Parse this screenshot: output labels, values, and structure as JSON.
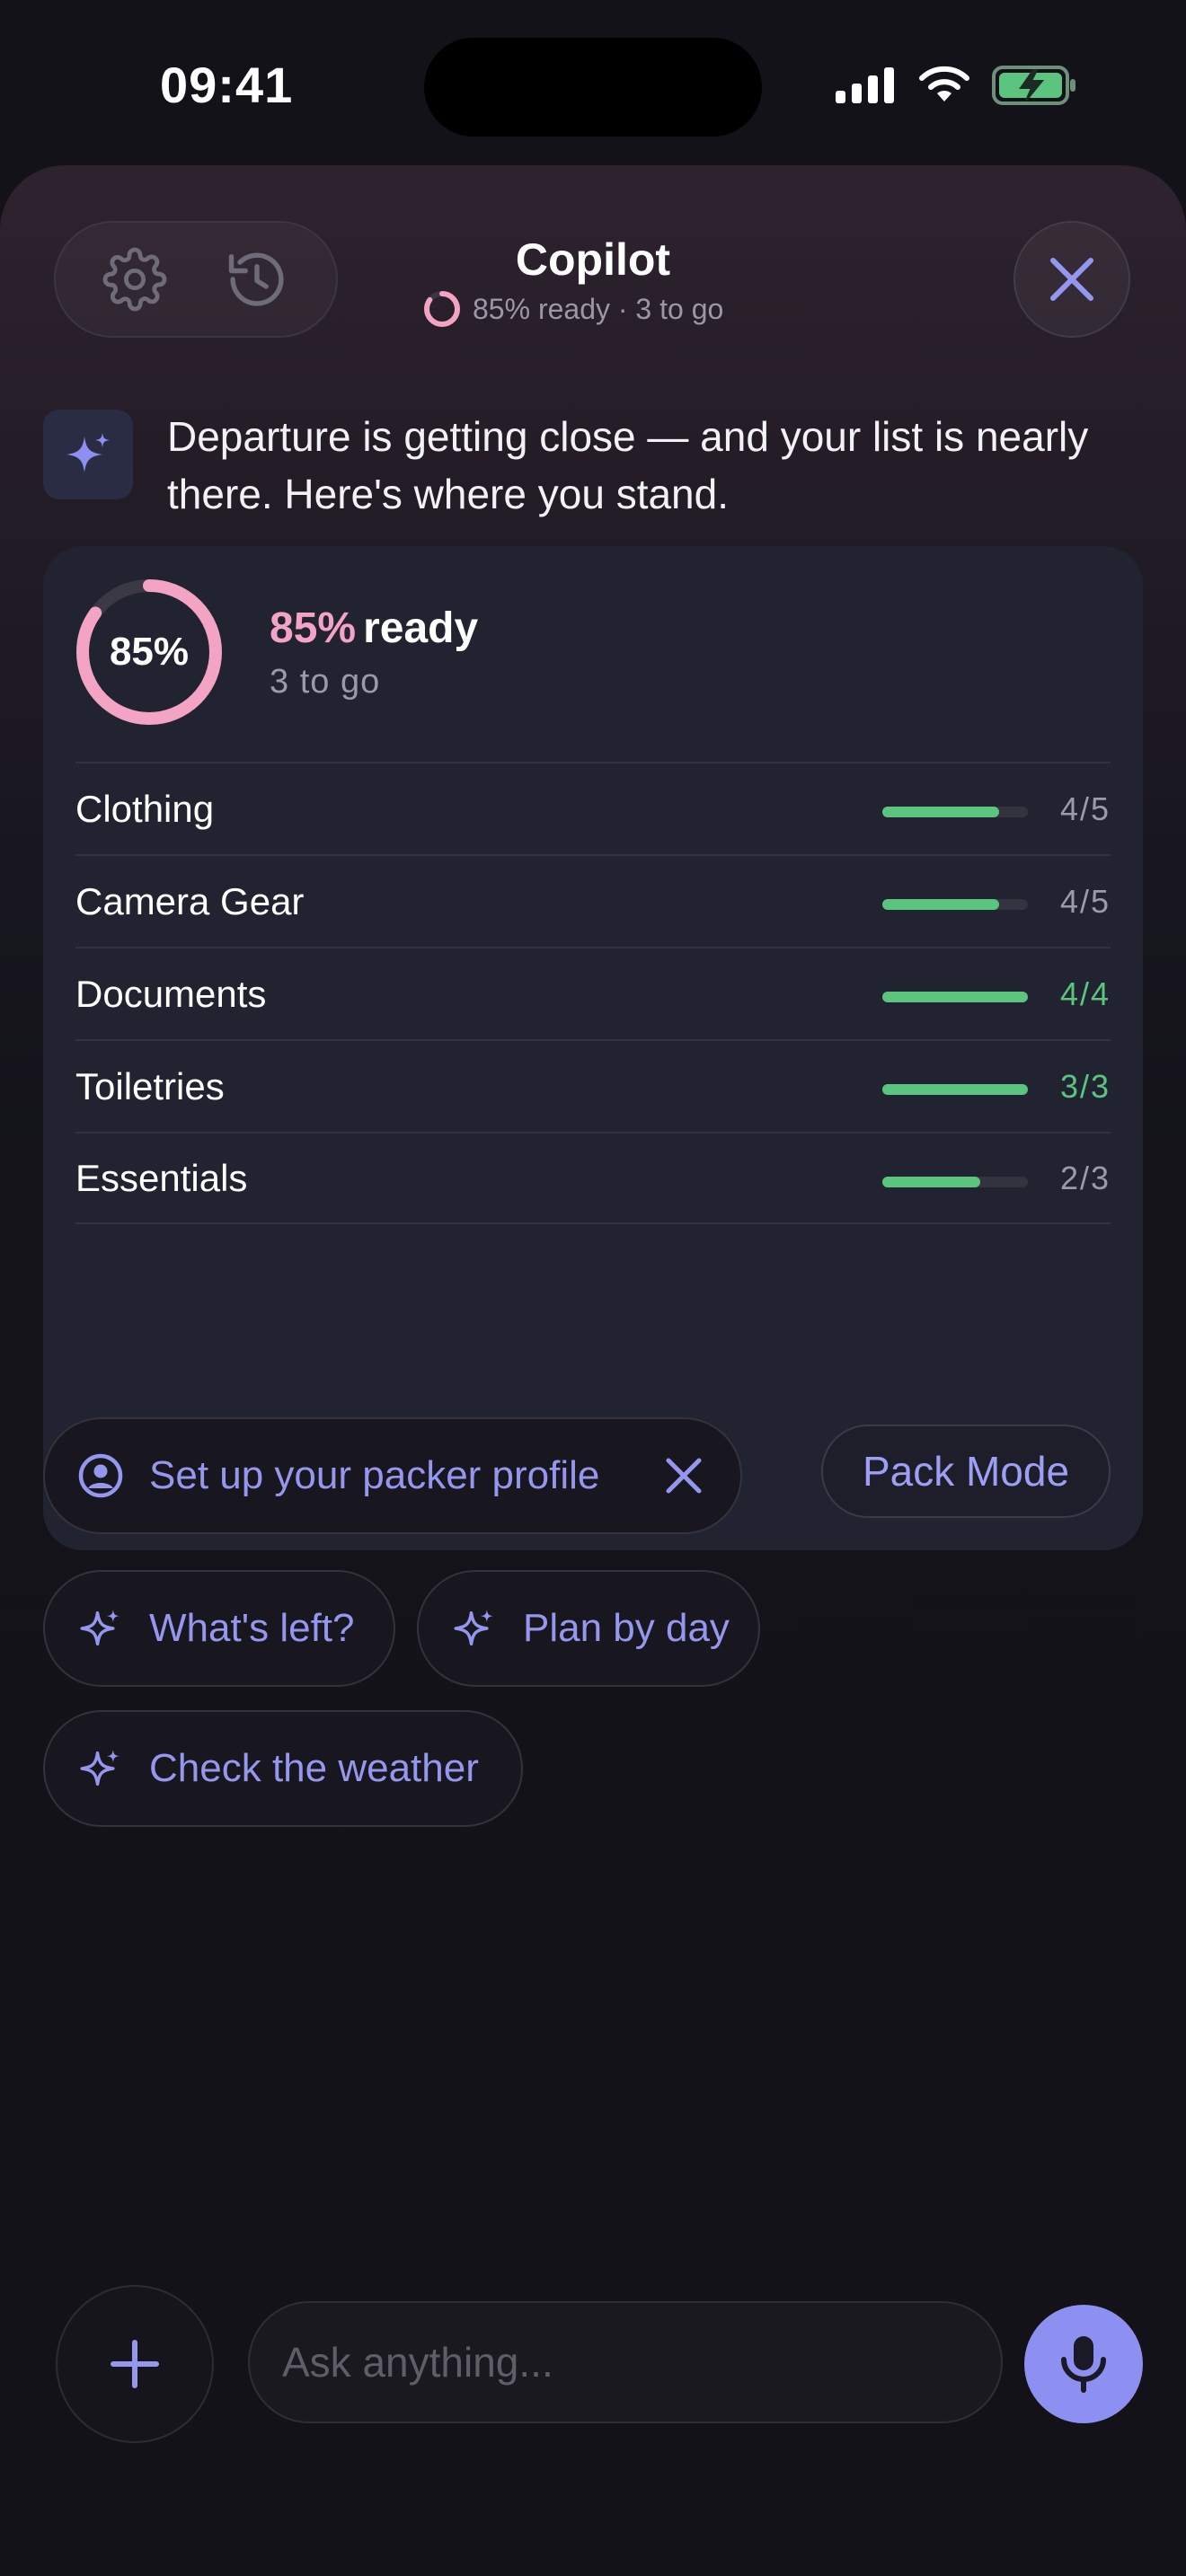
{
  "status_bar": {
    "time": "09:41"
  },
  "header": {
    "title": "Copilot",
    "subtitle": "85% ready · 3 to go",
    "icons": {
      "settings": "gear-icon",
      "history": "history-icon",
      "close": "close-icon"
    }
  },
  "assistant": {
    "message": "Departure is getting close — and your list is nearly there. Here's where you stand."
  },
  "summary_card": {
    "percent_label": "85%",
    "percent_value": 0.85,
    "ready_pct": "85%",
    "ready_word": "ready",
    "to_go": "3 to go",
    "categories": [
      {
        "label": "Clothing",
        "count": "4/5",
        "fraction": 0.8,
        "complete": false
      },
      {
        "label": "Camera Gear",
        "count": "4/5",
        "fraction": 0.8,
        "complete": false
      },
      {
        "label": "Documents",
        "count": "4/4",
        "fraction": 1.0,
        "complete": true
      },
      {
        "label": "Toiletries",
        "count": "3/3",
        "fraction": 1.0,
        "complete": true
      },
      {
        "label": "Essentials",
        "count": "2/3",
        "fraction": 0.67,
        "complete": false
      }
    ],
    "pack_mode_label": "Pack Mode"
  },
  "chips": {
    "profile": "Set up your packer profile",
    "whats_left": "What's left?",
    "plan_by_day": "Plan by day",
    "check_weather": "Check the weather"
  },
  "composer": {
    "placeholder": "Ask anything..."
  },
  "colors": {
    "accent": "#8d90f0",
    "progress_pink": "#f3a3c3",
    "success_green": "#5bc47f",
    "background": "#121218",
    "card": "#222330"
  }
}
